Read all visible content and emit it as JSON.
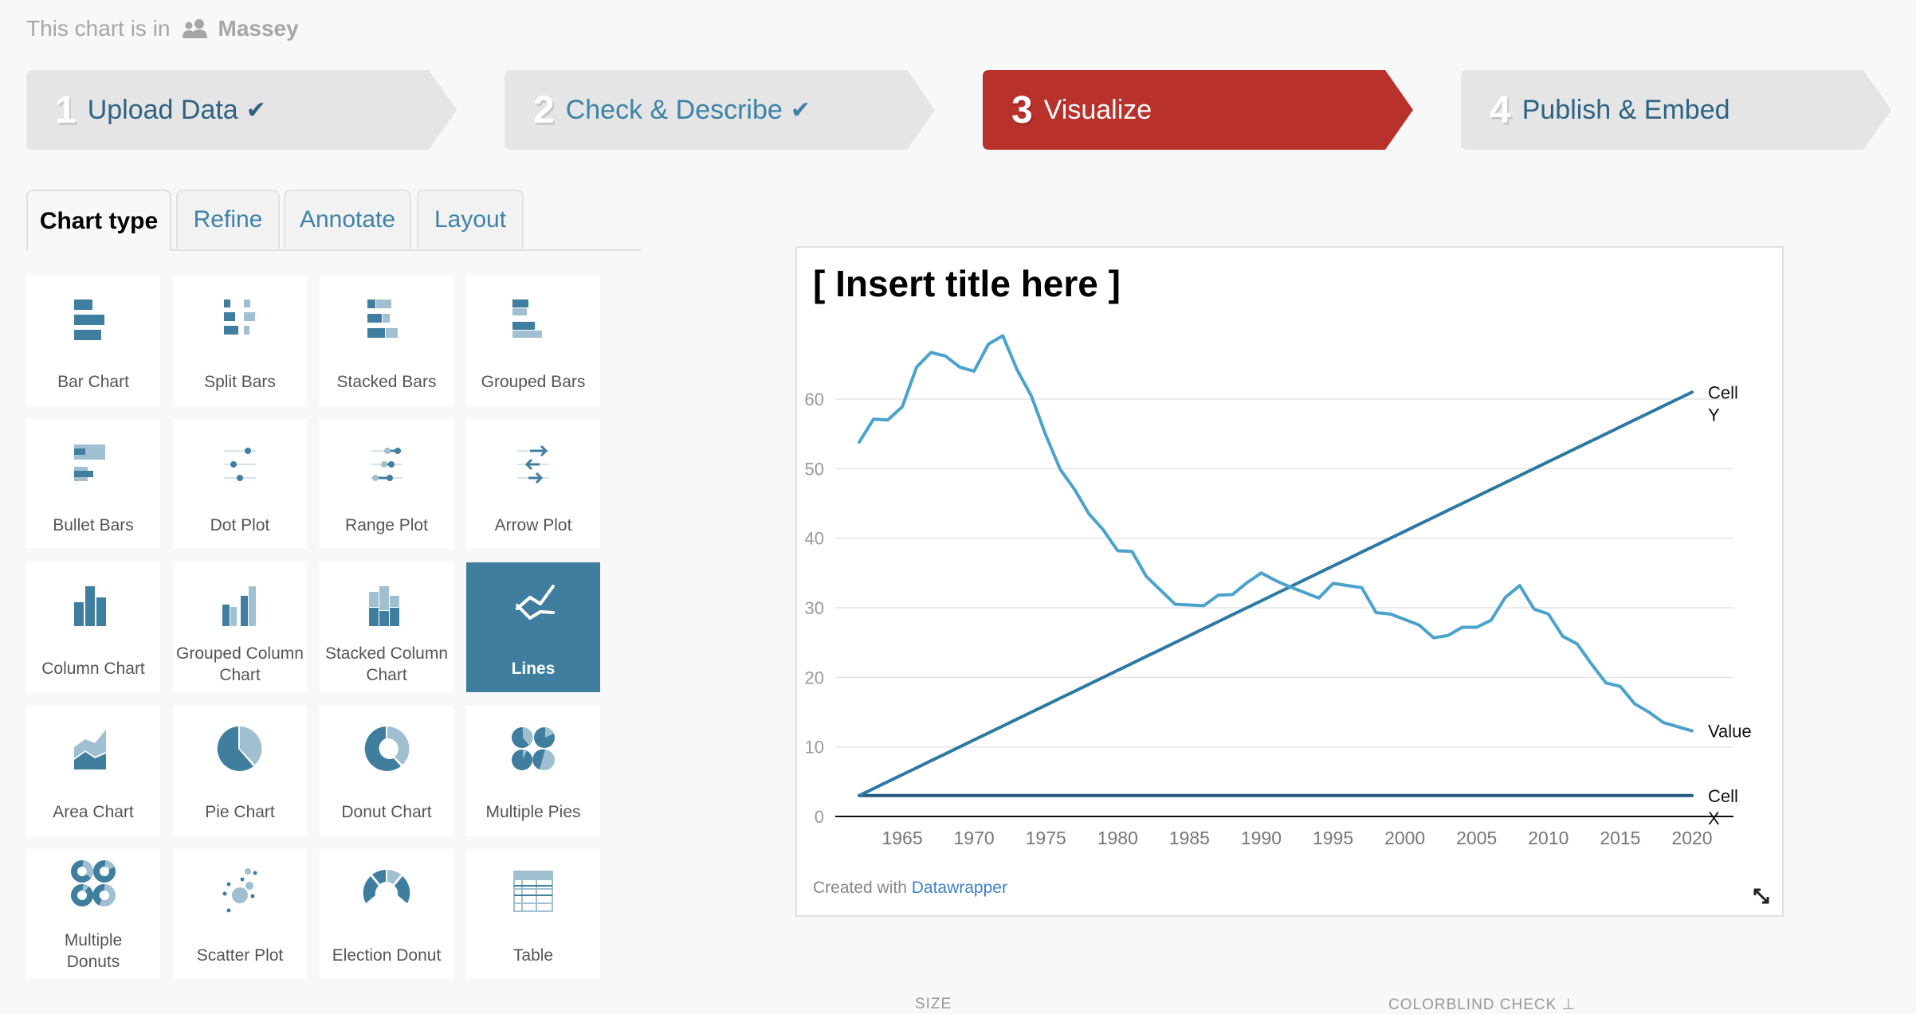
{
  "header": {
    "prefix": "This chart is in",
    "folder_icon": "users-icon",
    "folder_name": "Massey"
  },
  "steps": [
    {
      "number": "1",
      "label": "Upload Data",
      "status": "done",
      "check_icon": "✔"
    },
    {
      "number": "2",
      "label": "Check & Describe",
      "status": "done",
      "check_icon": "✔"
    },
    {
      "number": "3",
      "label": "Visualize",
      "status": "active"
    },
    {
      "number": "4",
      "label": "Publish & Embed",
      "status": "todo"
    }
  ],
  "tabs": [
    {
      "label": "Chart type",
      "active": true
    },
    {
      "label": "Refine",
      "active": false
    },
    {
      "label": "Annotate",
      "active": false
    },
    {
      "label": "Layout",
      "active": false
    }
  ],
  "chart_types": [
    {
      "label": "Bar Chart",
      "icon": "bar-chart-icon"
    },
    {
      "label": "Split Bars",
      "icon": "split-bars-icon"
    },
    {
      "label": "Stacked Bars",
      "icon": "stacked-bars-icon"
    },
    {
      "label": "Grouped Bars",
      "icon": "grouped-bars-icon"
    },
    {
      "label": "Bullet Bars",
      "icon": "bullet-bars-icon"
    },
    {
      "label": "Dot Plot",
      "icon": "dot-plot-icon"
    },
    {
      "label": "Range Plot",
      "icon": "range-plot-icon"
    },
    {
      "label": "Arrow Plot",
      "icon": "arrow-plot-icon"
    },
    {
      "label": "Column Chart",
      "icon": "column-chart-icon"
    },
    {
      "label": "Grouped Column Chart",
      "icon": "grouped-column-chart-icon"
    },
    {
      "label": "Stacked Column Chart",
      "icon": "stacked-column-chart-icon"
    },
    {
      "label": "Lines",
      "icon": "lines-icon",
      "selected": true
    },
    {
      "label": "Area Chart",
      "icon": "area-chart-icon"
    },
    {
      "label": "Pie Chart",
      "icon": "pie-chart-icon"
    },
    {
      "label": "Donut Chart",
      "icon": "donut-chart-icon"
    },
    {
      "label": "Multiple Pies",
      "icon": "multiple-pies-icon"
    },
    {
      "label": "Multiple Donuts",
      "icon": "multiple-donuts-icon"
    },
    {
      "label": "Scatter Plot",
      "icon": "scatter-plot-icon"
    },
    {
      "label": "Election Donut",
      "icon": "election-donut-icon"
    },
    {
      "label": "Table",
      "icon": "table-icon"
    }
  ],
  "preview": {
    "footer_prefix": "Created with",
    "footer_link": "Datawrapper",
    "resize_icon": "resize-icon"
  },
  "bottom": {
    "size_label": "SIZE",
    "colorblind_label": "COLORBLIND CHECK"
  },
  "colors": {
    "accent_red": "#b8312a",
    "tile_blue": "#3f7e9f",
    "tile_light_blue": "#a0bfd1",
    "value_line": "#4ba3cc",
    "cell_y_line": "#2e78a3",
    "cell_x_line": "#245a80",
    "link_blue": "#3f82c8"
  },
  "chart_data": {
    "type": "line",
    "title": "[ Insert title here ]",
    "xlabel": "",
    "ylabel": "",
    "xlim": [
      1962,
      2020
    ],
    "ylim": [
      0,
      60
    ],
    "yticks": [
      0,
      10,
      20,
      30,
      40,
      50,
      60
    ],
    "xticks": [
      1965,
      1970,
      1975,
      1980,
      1985,
      1990,
      1995,
      2000,
      2005,
      2010,
      2015,
      2020
    ],
    "grid": true,
    "legend": "direct-labels-right",
    "x": [
      1962,
      1963,
      1964,
      1965,
      1966,
      1967,
      1968,
      1969,
      1970,
      1971,
      1972,
      1973,
      1974,
      1975,
      1976,
      1977,
      1978,
      1979,
      1980,
      1981,
      1982,
      1983,
      1984,
      1985,
      1986,
      1987,
      1988,
      1989,
      1990,
      1991,
      1992,
      1993,
      1994,
      1995,
      1996,
      1997,
      1998,
      1999,
      2000,
      2001,
      2002,
      2003,
      2004,
      2005,
      2006,
      2007,
      2008,
      2009,
      2010,
      2011,
      2012,
      2013,
      2014,
      2015,
      2016,
      2017,
      2018,
      2019,
      2020
    ],
    "series": [
      {
        "name": "Value",
        "label_lines": [
          "Value"
        ],
        "color": "#4ba3cc",
        "values": [
          53.8,
          57.1,
          57.0,
          58.9,
          64.6,
          66.7,
          66.2,
          64.6,
          64.0,
          67.9,
          69.1,
          64.2,
          60.4,
          54.8,
          49.9,
          47.0,
          43.5,
          41.2,
          38.2,
          38.1,
          34.5,
          32.5,
          30.5,
          30.4,
          30.3,
          31.8,
          31.9,
          33.6,
          35.0,
          33.9,
          33.0,
          32.2,
          31.4,
          33.5,
          33.2,
          32.9,
          29.3,
          29.1,
          28.3,
          27.5,
          25.7,
          26.0,
          27.2,
          27.2,
          28.2,
          31.5,
          33.2,
          29.8,
          29.1,
          25.9,
          24.8,
          21.9,
          19.2,
          18.7,
          16.2,
          15.0,
          13.5,
          12.9,
          12.3
        ]
      },
      {
        "name": "Cell Y",
        "label_lines": [
          "Cell",
          "Y"
        ],
        "color": "#2e78a3",
        "values": [
          3,
          4,
          5,
          6,
          7,
          8,
          9,
          10,
          11,
          12,
          13,
          14,
          15,
          16,
          17,
          18,
          19,
          20,
          21,
          22,
          23,
          24,
          25,
          26,
          27,
          28,
          29,
          30,
          31,
          32,
          33,
          34,
          35,
          36,
          37,
          38,
          39,
          40,
          41,
          42,
          43,
          44,
          45,
          46,
          47,
          48,
          49,
          50,
          51,
          52,
          53,
          54,
          55,
          56,
          57,
          58,
          59,
          60,
          61
        ]
      },
      {
        "name": "Cell X",
        "label_lines": [
          "Cell",
          "X"
        ],
        "color": "#245a80",
        "values": [
          3,
          3,
          3,
          3,
          3,
          3,
          3,
          3,
          3,
          3,
          3,
          3,
          3,
          3,
          3,
          3,
          3,
          3,
          3,
          3,
          3,
          3,
          3,
          3,
          3,
          3,
          3,
          3,
          3,
          3,
          3,
          3,
          3,
          3,
          3,
          3,
          3,
          3,
          3,
          3,
          3,
          3,
          3,
          3,
          3,
          3,
          3,
          3,
          3,
          3,
          3,
          3,
          3,
          3,
          3,
          3,
          3,
          3,
          3
        ]
      }
    ]
  }
}
